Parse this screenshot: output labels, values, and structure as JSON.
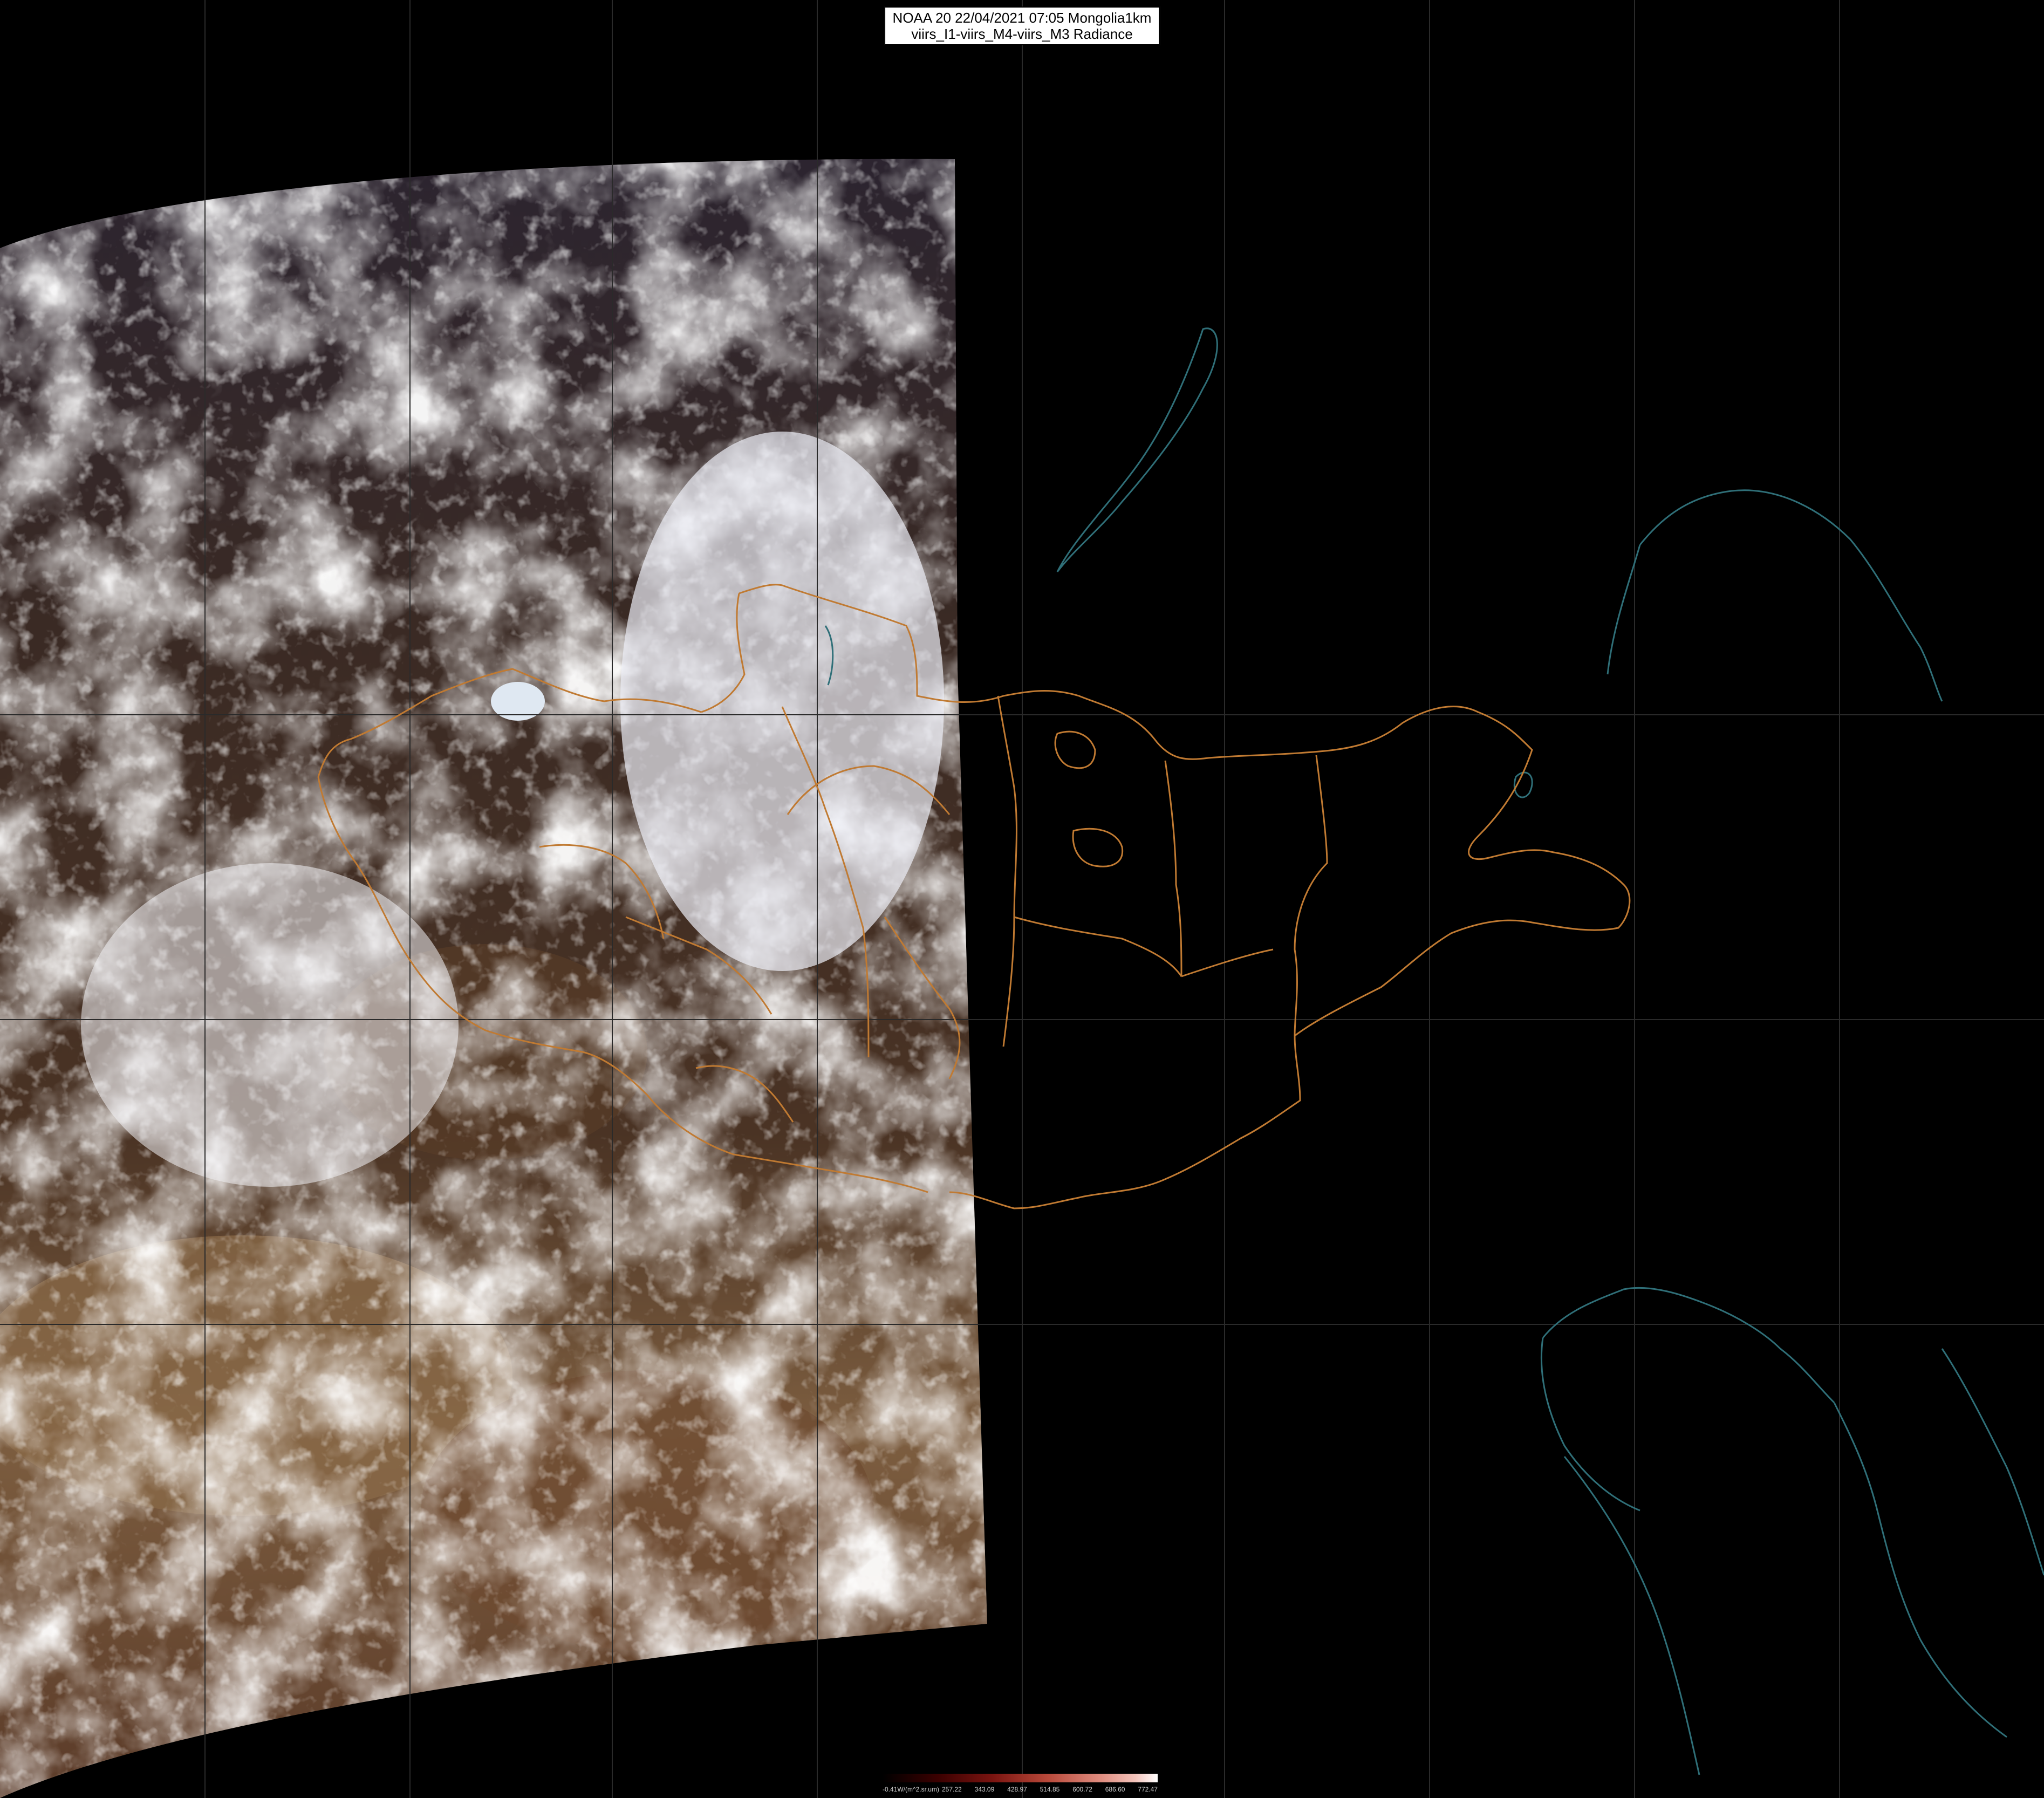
{
  "header": {
    "line1": "NOAA 20 22/04/2021 07:05 Mongolia1km",
    "line2": "viirs_I1-viirs_M4-viirs_M3 Radiance"
  },
  "legend": {
    "unit": "-0.41W/(m^2.sr.um)",
    "ticks": [
      "257.22",
      "343.09",
      "428.97",
      "514.85",
      "600.72",
      "686.60",
      "772.47"
    ],
    "colors": [
      "#000000",
      "#3a0000",
      "#7a1410",
      "#b8493a",
      "#e08f82",
      "#f4c4bc",
      "#ffffff"
    ]
  },
  "colors": {
    "background": "#000000",
    "grid": "#2a2a2a",
    "coastline": "#2f6f78",
    "admin_border": "#c07a32",
    "cloud": "#eef0f6",
    "terrain_dark": "#3a2a22",
    "desert": "#8a6a48"
  }
}
